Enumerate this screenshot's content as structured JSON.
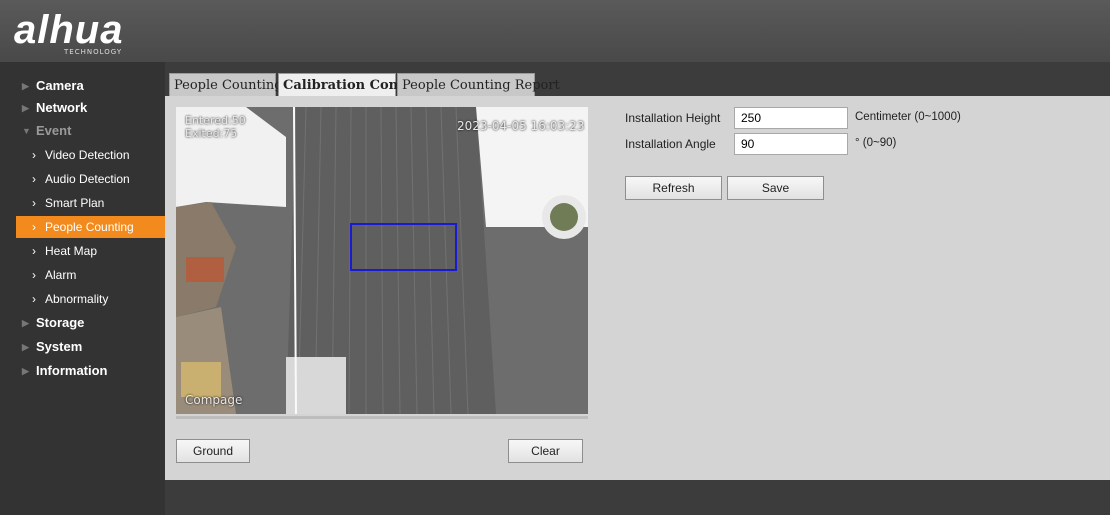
{
  "brand": {
    "name": "alhua",
    "sub": "TECHNOLOGY"
  },
  "sidebar": {
    "items": [
      {
        "label": "Camera"
      },
      {
        "label": "Network"
      },
      {
        "label": "Event"
      },
      {
        "label": "Video Detection"
      },
      {
        "label": "Audio Detection"
      },
      {
        "label": "Smart Plan"
      },
      {
        "label": "People Counting"
      },
      {
        "label": "Heat Map"
      },
      {
        "label": "Alarm"
      },
      {
        "label": "Abnormality"
      },
      {
        "label": "Storage"
      },
      {
        "label": "System"
      },
      {
        "label": "Information"
      }
    ]
  },
  "tabs": [
    {
      "label": "People Counting"
    },
    {
      "label": "Calibration Config"
    },
    {
      "label": "People Counting Report"
    }
  ],
  "video": {
    "entered": "Entered:50",
    "exited": "Exited:75",
    "timestamp": "2023-04-05 16:03:23",
    "watermark": "Compage"
  },
  "buttons": {
    "ground": "Ground",
    "clear": "Clear",
    "refresh": "Refresh",
    "save": "Save"
  },
  "form": {
    "height_label": "Installation Height",
    "height_value": "250",
    "height_unit": "Centimeter (0~1000)",
    "angle_label": "Installation Angle",
    "angle_value": "90",
    "angle_unit": "° (0~90)"
  },
  "colors": {
    "accent": "#f28a1d",
    "calibration_rect": "#1a1ad4"
  }
}
